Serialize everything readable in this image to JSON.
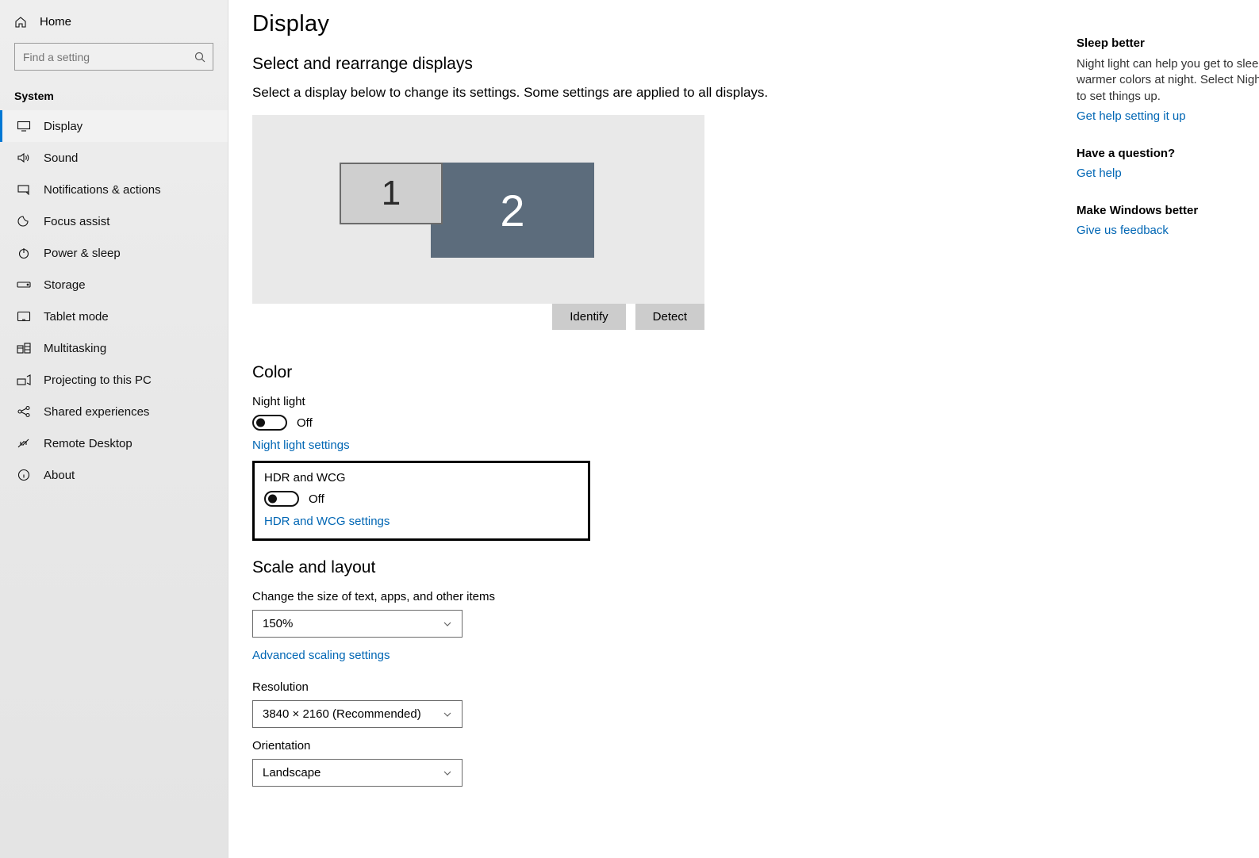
{
  "sidebar": {
    "home_label": "Home",
    "search_placeholder": "Find a setting",
    "heading": "System",
    "items": [
      {
        "label": "Display"
      },
      {
        "label": "Sound"
      },
      {
        "label": "Notifications & actions"
      },
      {
        "label": "Focus assist"
      },
      {
        "label": "Power & sleep"
      },
      {
        "label": "Storage"
      },
      {
        "label": "Tablet mode"
      },
      {
        "label": "Multitasking"
      },
      {
        "label": "Projecting to this PC"
      },
      {
        "label": "Shared experiences"
      },
      {
        "label": "Remote Desktop"
      },
      {
        "label": "About"
      }
    ]
  },
  "page": {
    "title": "Display",
    "arrange": {
      "title": "Select and rearrange displays",
      "body": "Select a display below to change its settings. Some settings are applied to all displays.",
      "identify": "Identify",
      "detect": "Detect",
      "monitors": {
        "m1": "1",
        "m2": "2"
      }
    },
    "color": {
      "title": "Color",
      "night_light_label": "Night light",
      "night_light_state": "Off",
      "night_light_settings_link": "Night light settings",
      "hdr_label": "HDR and WCG",
      "hdr_state": "Off",
      "hdr_settings_link": "HDR and WCG settings"
    },
    "scale": {
      "title": "Scale and layout",
      "text_size_label": "Change the size of text, apps, and other items",
      "text_size_value": "150%",
      "advanced_link": "Advanced scaling settings",
      "resolution_label": "Resolution",
      "resolution_value": "3840 × 2160 (Recommended)",
      "orientation_label": "Orientation",
      "orientation_value": "Landscape"
    }
  },
  "info": {
    "sleep": {
      "head": "Sleep better",
      "body": "Night light can help you get to sleep by displaying warmer colors at night. Select Night light settings to set things up.",
      "link": "Get help setting it up"
    },
    "q": {
      "head": "Have a question?",
      "link": "Get help"
    },
    "fb": {
      "head": "Make Windows better",
      "link": "Give us feedback"
    }
  }
}
